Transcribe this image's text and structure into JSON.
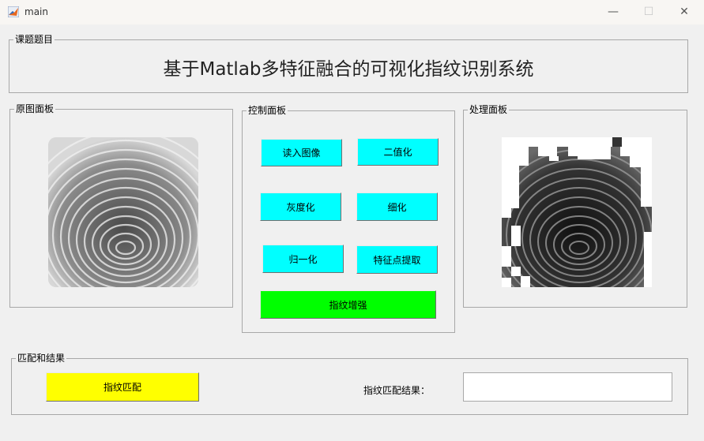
{
  "window": {
    "title": "main",
    "minimize_glyph": "—",
    "maximize_glyph": "☐",
    "close_glyph": "✕",
    "icon": "matlab-icon"
  },
  "header_panel": {
    "label": "课题题目",
    "title": "基于Matlab多特征融合的可视化指纹识别系统"
  },
  "original_panel": {
    "label": "原图面板"
  },
  "control_panel": {
    "label": "控制面板",
    "buttons": {
      "read_image": "读入图像",
      "binarize": "二值化",
      "grayscale": "灰度化",
      "thinning": "细化",
      "normalize": "归一化",
      "feature_extract": "特征点提取",
      "enhance": "指纹增强"
    }
  },
  "processed_panel": {
    "label": "处理面板"
  },
  "match_panel": {
    "label": "匹配和结果",
    "match_button": "指纹匹配",
    "result_label": "指纹匹配结果：",
    "result_value": ""
  },
  "colors": {
    "cyan": "#00ffff",
    "green": "#00ff00",
    "yellow": "#ffff00"
  }
}
